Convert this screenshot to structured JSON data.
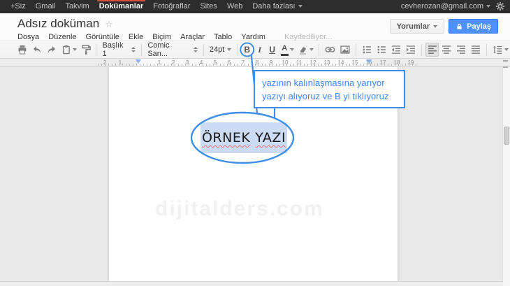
{
  "topbar": {
    "items": [
      "+Siz",
      "Gmail",
      "Takvim",
      "Dokümanlar",
      "Fotoğraflar",
      "Sites",
      "Web",
      "Daha fazlası"
    ],
    "active_item": "Dokümanlar",
    "account_email": "cevherozan@gmail.com"
  },
  "header": {
    "doc_title": "Adsız doküman",
    "menus": [
      "Dosya",
      "Düzenle",
      "Görüntüle",
      "Ekle",
      "Biçim",
      "Araçlar",
      "Tablo",
      "Yardım"
    ],
    "save_status": "Kaydediliyor...",
    "comments_label": "Yorumlar",
    "share_label": "Paylaş"
  },
  "toolbar": {
    "style_label": "Başlık 1",
    "font_label": "Comic San...",
    "size_label": "24pt",
    "bold_label": "B",
    "italic_label": "I",
    "underline_label": "U",
    "text_color_label": "A"
  },
  "ruler": {
    "margin_numbers": [
      "2",
      "1"
    ],
    "numbers": [
      "1",
      "2",
      "3",
      "4",
      "5",
      "6",
      "7",
      "8",
      "9",
      "10",
      "11",
      "12",
      "13",
      "14",
      "15",
      "16",
      "17",
      "18",
      "19"
    ]
  },
  "document": {
    "words": [
      "ÖRNEK",
      "YAZI"
    ]
  },
  "callout": {
    "line1": "yazının kalınlaşmasına yarıyor",
    "line2": "yazıyı alıyoruz ve B yi tıklıyoruz"
  },
  "watermark": "dijitalders.com",
  "colors": {
    "annotation_blue": "#3d8ee9",
    "callout_text": "#4285f4",
    "selection_highlight": "#cddcf5",
    "share_button_blue": "#4d90fe",
    "active_tab_red": "#dd4b39",
    "spellcheck_red": "#e57373"
  },
  "icons": [
    "printer-icon",
    "undo-icon",
    "redo-icon",
    "web-clipboard-icon",
    "paint-format-icon",
    "chevron-down-icon",
    "updown-icon",
    "link-icon",
    "insert-image-icon",
    "numbered-list-icon",
    "bulleted-list-icon",
    "decrease-indent-icon",
    "increase-indent-icon",
    "align-left-icon",
    "align-center-icon",
    "align-right-icon",
    "justify-icon",
    "line-spacing-icon",
    "lock-icon",
    "gear-icon",
    "star-icon"
  ]
}
